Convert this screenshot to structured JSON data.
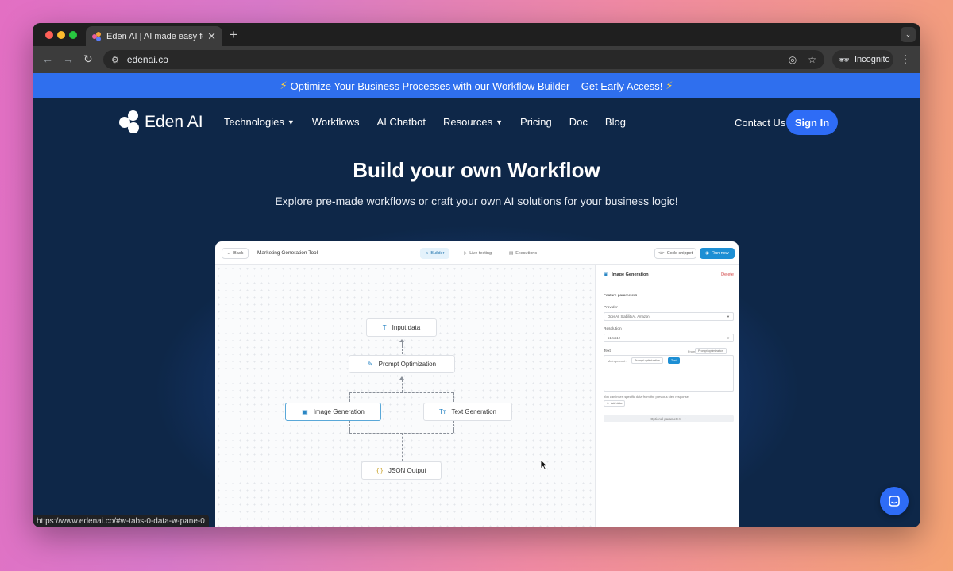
{
  "browser": {
    "tab_title": "Eden AI | AI made easy for Pro",
    "url": "edenai.co",
    "incognito_label": "Incognito",
    "status_url": "https://www.edenai.co/#w-tabs-0-data-w-pane-0"
  },
  "banner": {
    "text": "Optimize Your Business Processes with our Workflow Builder  – Get Early Access!",
    "icon": "lightning-icon"
  },
  "nav": {
    "logo_text": "Eden AI",
    "links": [
      {
        "label": "Technologies",
        "dropdown": true
      },
      {
        "label": "Workflows"
      },
      {
        "label": "AI Chatbot"
      },
      {
        "label": "Resources",
        "dropdown": true
      },
      {
        "label": "Pricing"
      },
      {
        "label": "Doc"
      },
      {
        "label": "Blog"
      }
    ],
    "contact": "Contact Us",
    "signin": "Sign In"
  },
  "hero": {
    "title": "Build your own Workflow",
    "subtitle": "Explore pre-made workflows or craft your own  AI solutions for your business logic!"
  },
  "preview": {
    "back": "Back",
    "title": "Marketing Generation Tool",
    "tabs": [
      "Builder",
      "Live testing",
      "Executions"
    ],
    "code_snippet": "Code snippet",
    "run_now": "Run now",
    "nodes": {
      "input": "Input data",
      "prompt": "Prompt Optimization",
      "image": "Image Generation",
      "text": "Text Generation",
      "json": "JSON Output"
    },
    "panel": {
      "title": "Image Generation",
      "delete": "Delete",
      "section": "Feature parameters",
      "provider_label": "Provider",
      "provider_value": "OpenAI, StabilityAI, Amazon",
      "resolution_label": "Resolution",
      "resolution_value": "512x512",
      "text_label": "Text",
      "text_from": "From",
      "text_from_chip": "Prompt optimization",
      "textarea_prefix": "Main prompt :",
      "textarea_chip": "Prompt optimization",
      "textarea_chip2": "Text",
      "hint": "You can insert specific data from the previous step response",
      "add_data": "Add data",
      "optional": "Optional parameters"
    }
  },
  "colors": {
    "page_bg": "#0e2748",
    "accent": "#2e6cf6",
    "banner": "#2f6fee"
  }
}
